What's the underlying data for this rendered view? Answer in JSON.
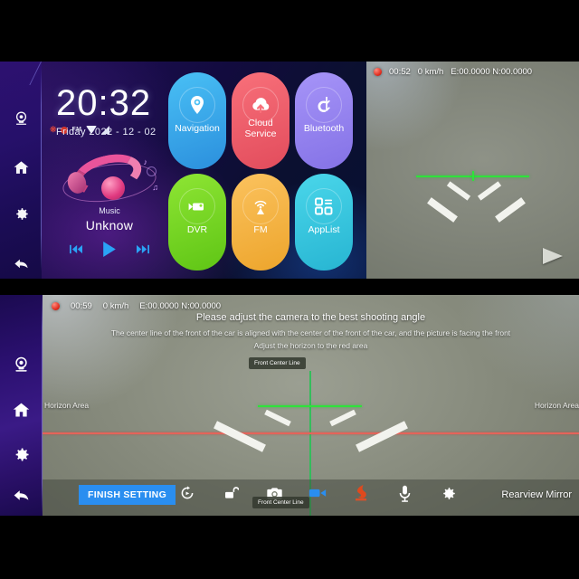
{
  "launcher": {
    "clock": {
      "time": "20:32",
      "date": "Friday  2022 - 12 - 02"
    },
    "status_icons": [
      "bluetooth-icon",
      "record-dot-icon",
      "fm-icon",
      "wifi-icon",
      "signal-icon"
    ],
    "status_fm_label": "FM",
    "music": {
      "label": "Music",
      "title": "Unknow",
      "controls": [
        "previous-track-button",
        "play-button",
        "next-track-button"
      ]
    },
    "sidebar": [
      {
        "name": "camera",
        "icon": "camera-icon"
      },
      {
        "name": "home",
        "icon": "home-icon"
      },
      {
        "name": "settings",
        "icon": "gear-icon"
      },
      {
        "name": "back",
        "icon": "back-arrow-icon"
      }
    ],
    "tiles": [
      {
        "label": "Navigation",
        "icon": "map-pin-icon",
        "color": "#3fb4ef",
        "color2": "#2a93e0"
      },
      {
        "label": "Cloud\nService",
        "icon": "cloud-upload-icon",
        "color": "#f0606b",
        "color2": "#e2525f"
      },
      {
        "label": "Bluetooth",
        "icon": "bluetooth-icon",
        "color": "#9a86f0",
        "color2": "#8a74e8"
      },
      {
        "label": "DVR",
        "icon": "video-camera-icon",
        "color": "#7ddc2a",
        "color2": "#62c617"
      },
      {
        "label": "FM",
        "icon": "radio-wave-icon",
        "color": "#f6b54a",
        "color2": "#f0a733"
      },
      {
        "label": "AppList",
        "icon": "app-grid-icon",
        "color": "#3fc9e0",
        "color2": "#2bb8d4"
      }
    ]
  },
  "camera_top": {
    "osd": {
      "rec": "record-indicator",
      "time": "00:52",
      "speed": "0 km/h",
      "coords": "E:00.0000 N:00.0000"
    },
    "overlay": {
      "guide_line_color": "#2fe23b"
    },
    "play_arrow": "play-arrow-icon"
  },
  "camera_bottom": {
    "osd": {
      "rec": "record-indicator",
      "time": "00:59",
      "speed": "0 km/h",
      "coords": "E:00.0000 N:00.0000"
    },
    "hint_main": "Please adjust the camera to the best shooting angle",
    "hint_line1": "The center line of the front of the car is aligned with the center of the front of the car, and the picture is facing the front",
    "hint_line2": "Adjust the horizon to the red area",
    "tag_top": "Front Center Line",
    "tag_bottom": "Front Center Line",
    "horizon_left_label": "Horizon Area",
    "horizon_right_label": "Horizon Area",
    "horizon_color": "#e4645a",
    "center_line_color": "#2fbf5a",
    "sidebar": [
      {
        "name": "camera",
        "icon": "camera-icon"
      },
      {
        "name": "home",
        "icon": "home-icon"
      },
      {
        "name": "settings",
        "icon": "gear-icon"
      },
      {
        "name": "back",
        "icon": "back-arrow-icon"
      }
    ],
    "toolbar": {
      "finish_label": "FINISH SETTING",
      "accent_color": "#2a8ef0",
      "icons": [
        {
          "name": "rotate-icon"
        },
        {
          "name": "unlock-icon"
        },
        {
          "name": "photo-camera-icon"
        },
        {
          "name": "video-record-icon"
        },
        {
          "name": "emergency-lock-icon"
        },
        {
          "name": "microphone-icon"
        },
        {
          "name": "gear-icon"
        }
      ],
      "mirror_label": "Rearview Mirror"
    }
  }
}
